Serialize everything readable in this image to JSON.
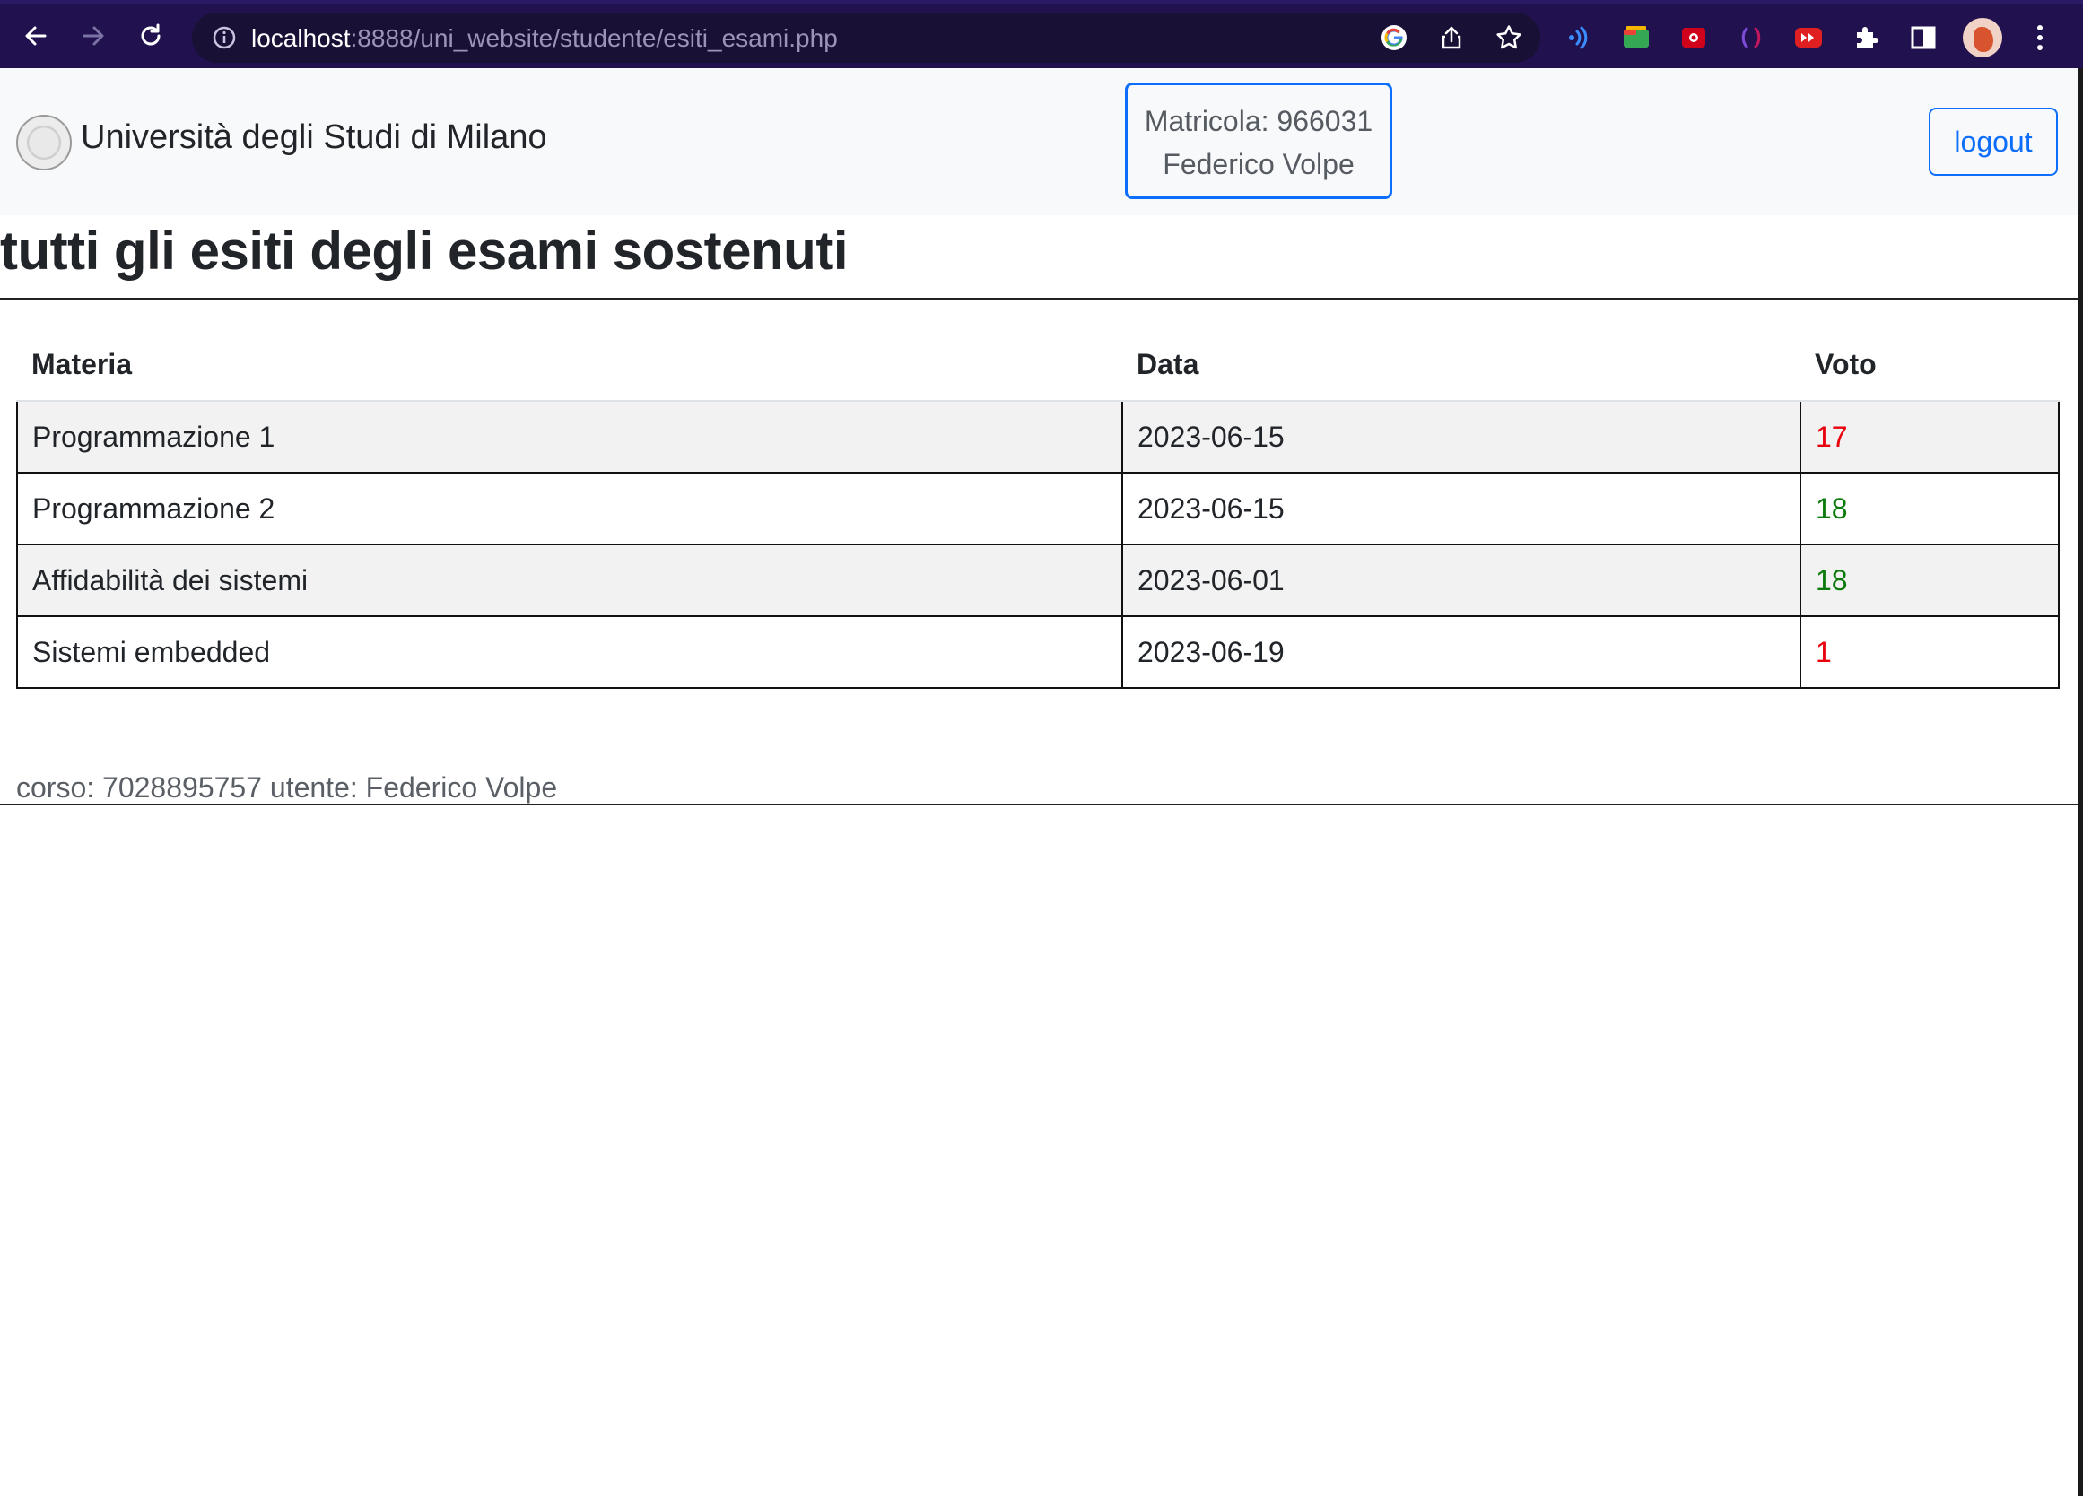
{
  "browser": {
    "url_host": "localhost",
    "url_path": ":8888/uni_website/studente/esiti_esami.php"
  },
  "header": {
    "brand": "Università degli Studi di Milano",
    "matricola": "Matricola: 966031",
    "user_name": "Federico Volpe",
    "logout_label": "logout"
  },
  "main": {
    "title": "tutti gli esiti degli esami sostenuti",
    "table": {
      "headers": [
        "Materia",
        "Data",
        "Voto"
      ],
      "rows": [
        {
          "materia": "Programmazione 1",
          "data": "2023-06-15",
          "voto": "17",
          "status": "fail"
        },
        {
          "materia": "Programmazione 2",
          "data": "2023-06-15",
          "voto": "18",
          "status": "pass"
        },
        {
          "materia": "Affidabilità dei sistemi",
          "data": "2023-06-01",
          "voto": "18",
          "status": "pass"
        },
        {
          "materia": "Sistemi embedded",
          "data": "2023-06-19",
          "voto": "1",
          "status": "fail"
        }
      ]
    },
    "footer": "corso: 7028895757 utente: Federico Volpe"
  },
  "colors": {
    "fail": "#e8000b",
    "pass": "#0a7a0a",
    "accent": "#0d6efd"
  }
}
